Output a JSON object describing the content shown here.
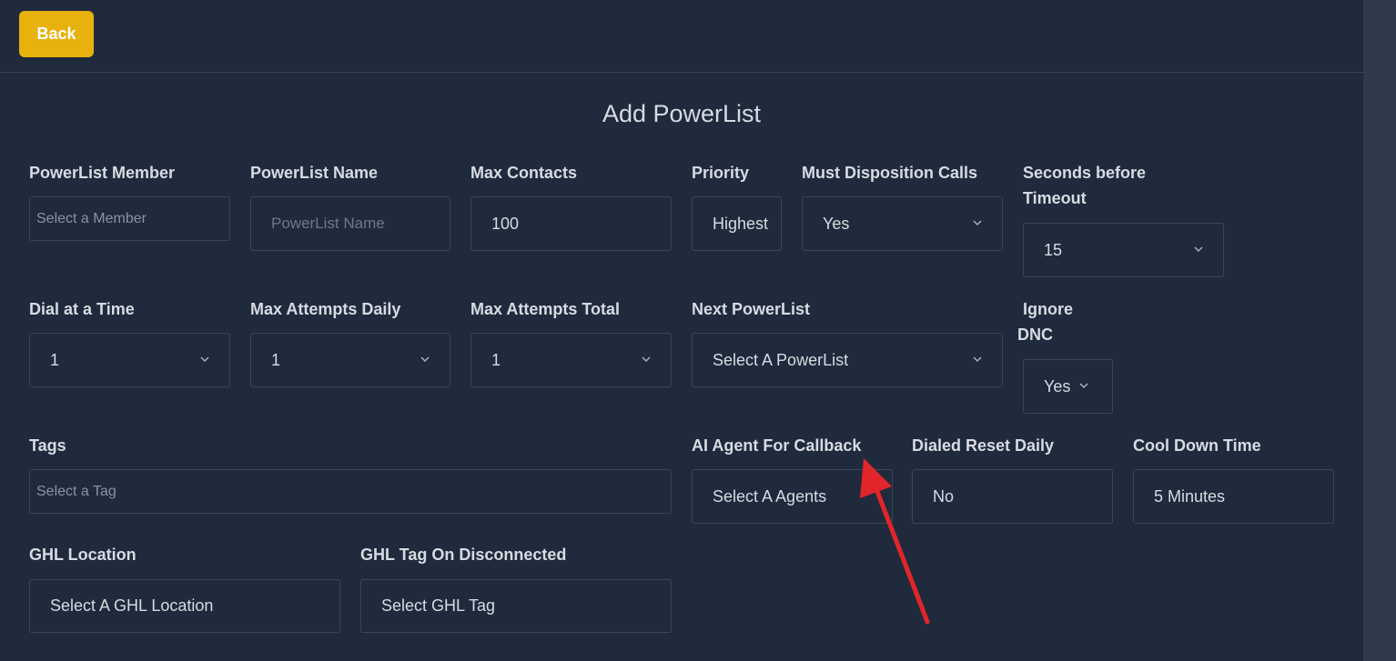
{
  "header": {
    "back_label": "Back"
  },
  "title": "Add PowerList",
  "fields": {
    "member": {
      "label": "PowerList Member",
      "placeholder": "Select a Member"
    },
    "name": {
      "label": "PowerList Name",
      "placeholder": "PowerList Name"
    },
    "max_contacts": {
      "label": "Max Contacts",
      "value": "100"
    },
    "priority": {
      "label": "Priority",
      "value": "Highest"
    },
    "must_disposition": {
      "label": "Must Disposition Calls",
      "value": "Yes"
    },
    "timeout": {
      "label_line1": "Seconds before",
      "label_line2": "Timeout",
      "value": "15"
    },
    "dial_at_time": {
      "label": "Dial at a Time",
      "value": "1"
    },
    "max_attempts_daily": {
      "label": "Max Attempts Daily",
      "value": "1"
    },
    "max_attempts_total": {
      "label": "Max Attempts Total",
      "value": "1"
    },
    "next_powerlist": {
      "label": "Next PowerList",
      "value": "Select A PowerList"
    },
    "ignore_dnc": {
      "label_line1": "Ignore",
      "label_line2": "DNC",
      "value": "Yes"
    },
    "tags": {
      "label": "Tags",
      "placeholder": "Select a Tag"
    },
    "ai_agent": {
      "label": "AI Agent For Callback",
      "value": "Select A Agents"
    },
    "dialed_reset": {
      "label": "Dialed Reset Daily",
      "value": "No"
    },
    "cool_down": {
      "label": "Cool Down Time",
      "value": "5 Minutes"
    },
    "ghl_location": {
      "label": "GHL Location",
      "value": "Select A GHL Location"
    },
    "ghl_tag": {
      "label": "GHL Tag On Disconnected",
      "value": "Select GHL Tag"
    }
  },
  "annotation": {
    "arrow_color": "#e0262b"
  }
}
